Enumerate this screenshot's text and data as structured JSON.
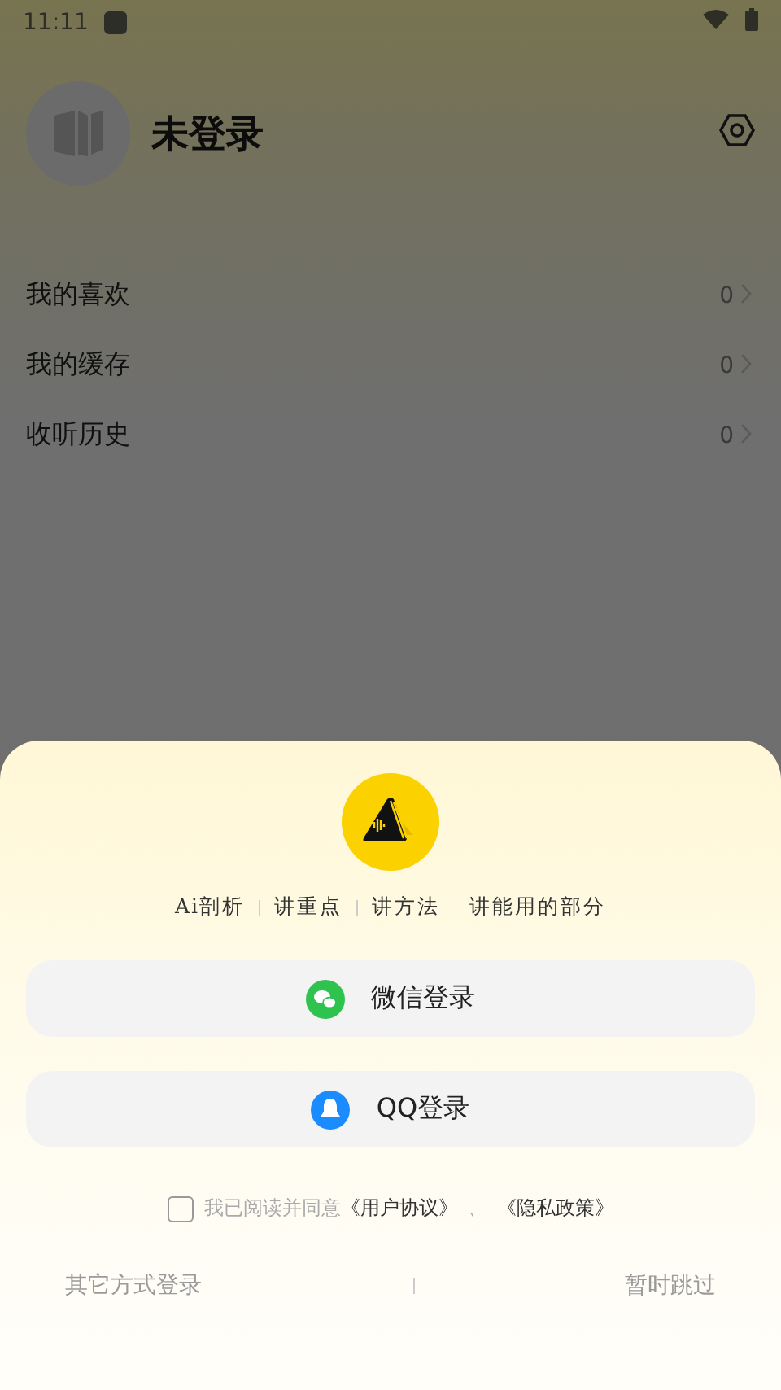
{
  "status_bar": {
    "time": "11:11"
  },
  "profile": {
    "name": "未登录"
  },
  "menu": [
    {
      "label": "我的喜欢",
      "count": "0"
    },
    {
      "label": "我的缓存",
      "count": "0"
    },
    {
      "label": "收听历史",
      "count": "0"
    }
  ],
  "login_sheet": {
    "tagline": [
      {
        "text": "Ai剖析",
        "separator": true
      },
      {
        "text": "讲重点",
        "separator": true
      },
      {
        "text": "讲方法",
        "separator": false
      },
      {
        "text": "讲能用的部分",
        "separator": false
      }
    ],
    "buttons": [
      {
        "kind": "wechat",
        "label": "微信登录"
      },
      {
        "kind": "qq",
        "label": "QQ登录"
      }
    ],
    "agreement": {
      "checked": false,
      "text": "我已阅读并同意",
      "links": [
        "《用户协议》",
        "《隐私政策》"
      ],
      "joiner": "、"
    },
    "other_login": "其它方式登录",
    "skip": "暂时跳过"
  }
}
